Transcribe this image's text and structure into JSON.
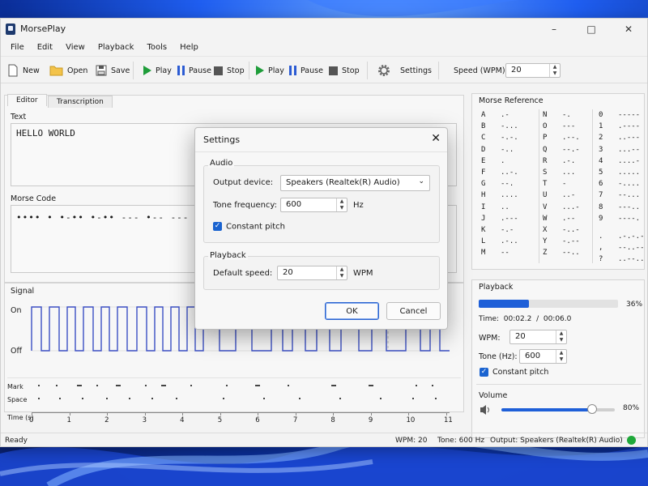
{
  "window": {
    "title": "MorsePlay"
  },
  "menu": [
    "File",
    "Edit",
    "View",
    "Playback",
    "Tools",
    "Help"
  ],
  "toolbar": {
    "new": "New",
    "open": "Open",
    "save": "Save",
    "play1": "Play",
    "pause1": "Pause",
    "stop1": "Stop",
    "play2": "Play",
    "pause2": "Pause",
    "stop2": "Stop",
    "settings": "Settings",
    "speed_label": "Speed (WPM):",
    "speed_value": "20"
  },
  "editor": {
    "tabs": [
      "Editor",
      "Transcription"
    ],
    "text_label": "Text",
    "text_value": "HELLO WORLD",
    "morse_label": "Morse Code",
    "morse_value": "•••• • •-•• •-•• ---  •-- --- •"
  },
  "signal": {
    "title": "Signal",
    "on_label": "On",
    "off_label": "Off",
    "mark_label": "Mark",
    "space_label": "Space",
    "time_label": "Time (s)",
    "ticks": [
      "0",
      "1",
      "2",
      "3",
      "4",
      "5",
      "6",
      "7",
      "8",
      "9",
      "10",
      "11"
    ]
  },
  "reference": {
    "title": "Morse Reference",
    "col1": [
      [
        "A",
        ".-"
      ],
      [
        "B",
        "-..."
      ],
      [
        "C",
        "-.-."
      ],
      [
        "D",
        "-.."
      ],
      [
        "E",
        "."
      ],
      [
        "F",
        "..-."
      ],
      [
        "G",
        "--."
      ],
      [
        "H",
        "...."
      ],
      [
        "I",
        ".."
      ],
      [
        "J",
        ".---"
      ],
      [
        "K",
        "-.-"
      ],
      [
        "L",
        ".-.."
      ],
      [
        "M",
        "--"
      ]
    ],
    "col2": [
      [
        "N",
        "-."
      ],
      [
        "O",
        "---"
      ],
      [
        "P",
        ".--."
      ],
      [
        "Q",
        "--.-"
      ],
      [
        "R",
        ".-."
      ],
      [
        "S",
        "..."
      ],
      [
        "T",
        "-"
      ],
      [
        "U",
        "..-"
      ],
      [
        "V",
        "...-"
      ],
      [
        "W",
        ".--"
      ],
      [
        "X",
        "-..-"
      ],
      [
        "Y",
        "-.--"
      ],
      [
        "Z",
        "--.."
      ]
    ],
    "col3": [
      [
        "0",
        "-----"
      ],
      [
        "1",
        ".----"
      ],
      [
        "2",
        "..---"
      ],
      [
        "3",
        "...--"
      ],
      [
        "4",
        "....-"
      ],
      [
        "5",
        "....."
      ],
      [
        "6",
        "-...."
      ],
      [
        "7",
        "--..."
      ],
      [
        "8",
        "---.."
      ],
      [
        "9",
        "----."
      ]
    ],
    "col3b": [
      [
        ".",
        ".-.-.-"
      ],
      [
        ",",
        "--..--"
      ],
      [
        "?",
        "..--.."
      ]
    ]
  },
  "playback": {
    "title": "Playback",
    "progress_pct": 36,
    "progress_text": "36%",
    "time_label": "Time:",
    "time_current": "00:02.2",
    "time_sep": "/",
    "time_total": "00:06.0",
    "wpm_label": "WPM:",
    "wpm_value": "20",
    "tone_label": "Tone (Hz):",
    "tone_value": "600",
    "constant_pitch": "Constant pitch",
    "volume_label": "Volume",
    "volume_pct": 80,
    "volume_text": "80%"
  },
  "status": {
    "ready": "Ready",
    "wpm": "WPM:  20",
    "tone": "Tone:  600 Hz",
    "output": "Output:  Speakers (Realtek(R) Audio)",
    "indicator_color": "#1fa83a"
  },
  "dialog": {
    "title": "Settings",
    "audio_group": "Audio",
    "output_label": "Output device:",
    "output_value": "Speakers (Realtek(R) Audio)",
    "freq_label": "Tone frequency:",
    "freq_value": "600",
    "freq_unit": "Hz",
    "constant_pitch": "Constant pitch",
    "playback_group": "Playback",
    "speed_label": "Default speed:",
    "speed_value": "20",
    "speed_unit": "WPM",
    "ok": "OK",
    "cancel": "Cancel"
  },
  "colors": {
    "accent": "#1e5fd8",
    "signal": "#3b4fc4",
    "play": "#1f9d3a"
  }
}
